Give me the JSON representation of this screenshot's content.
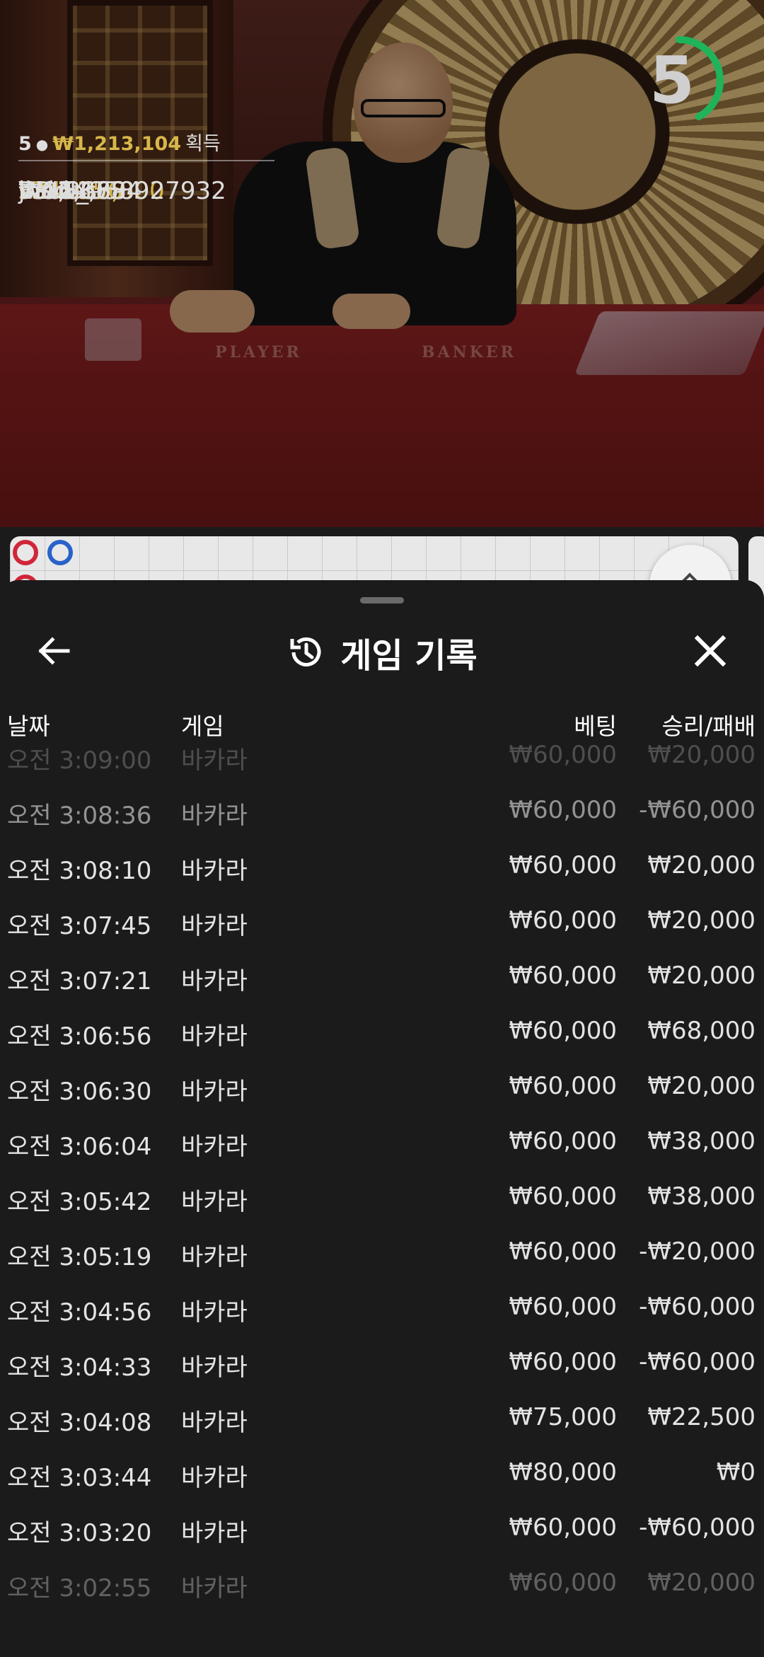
{
  "timer": {
    "value": "5",
    "fraction": 0.42,
    "color": "#1fb35a"
  },
  "winners": {
    "count": "5",
    "total": "₩1,213,104",
    "gain_label": "획득",
    "top_amount": "₩1,000,000",
    "top_name": "s345356",
    "list": [
      {
        "amount": "₩174,884",
        "name": "BBIN_958927932"
      },
      {
        "amount": "₩16,183",
        "name": "Vaidas"
      },
      {
        "amount": "₩12,169",
        "name": "jhe"
      },
      {
        "amount": "₩9,867",
        "name": "hau"
      }
    ]
  },
  "table_labels": {
    "player": "PLAYER",
    "banker": "BANKER"
  },
  "roadmap": {
    "dots": [
      {
        "color": "#d0263a"
      },
      {
        "color": "#2a62c9"
      },
      {
        "color": "#d0263a"
      }
    ]
  },
  "history": {
    "title": "게임 기록",
    "icons": {
      "back": "arrow-left-icon",
      "history": "history-icon",
      "close": "close-icon"
    },
    "columns": {
      "date": "날짜",
      "game": "게임",
      "bet": "베팅",
      "result": "승리/패배"
    },
    "rows": [
      {
        "date": "오전 3:09:00",
        "game": "바카라",
        "bet": "₩60,000",
        "result": "₩20,000"
      },
      {
        "date": "오전 3:08:36",
        "game": "바카라",
        "bet": "₩60,000",
        "result": "-₩60,000"
      },
      {
        "date": "오전 3:08:10",
        "game": "바카라",
        "bet": "₩60,000",
        "result": "₩20,000"
      },
      {
        "date": "오전 3:07:45",
        "game": "바카라",
        "bet": "₩60,000",
        "result": "₩20,000"
      },
      {
        "date": "오전 3:07:21",
        "game": "바카라",
        "bet": "₩60,000",
        "result": "₩20,000"
      },
      {
        "date": "오전 3:06:56",
        "game": "바카라",
        "bet": "₩60,000",
        "result": "₩68,000"
      },
      {
        "date": "오전 3:06:30",
        "game": "바카라",
        "bet": "₩60,000",
        "result": "₩20,000"
      },
      {
        "date": "오전 3:06:04",
        "game": "바카라",
        "bet": "₩60,000",
        "result": "₩38,000"
      },
      {
        "date": "오전 3:05:42",
        "game": "바카라",
        "bet": "₩60,000",
        "result": "₩38,000"
      },
      {
        "date": "오전 3:05:19",
        "game": "바카라",
        "bet": "₩60,000",
        "result": "-₩20,000"
      },
      {
        "date": "오전 3:04:56",
        "game": "바카라",
        "bet": "₩60,000",
        "result": "-₩60,000"
      },
      {
        "date": "오전 3:04:33",
        "game": "바카라",
        "bet": "₩60,000",
        "result": "-₩60,000"
      },
      {
        "date": "오전 3:04:08",
        "game": "바카라",
        "bet": "₩75,000",
        "result": "₩22,500"
      },
      {
        "date": "오전 3:03:44",
        "game": "바카라",
        "bet": "₩80,000",
        "result": "₩0"
      },
      {
        "date": "오전 3:03:20",
        "game": "바카라",
        "bet": "₩60,000",
        "result": "-₩60,000"
      },
      {
        "date": "오전 3:02:55",
        "game": "바카라",
        "bet": "₩60,000",
        "result": "₩20,000"
      }
    ]
  }
}
